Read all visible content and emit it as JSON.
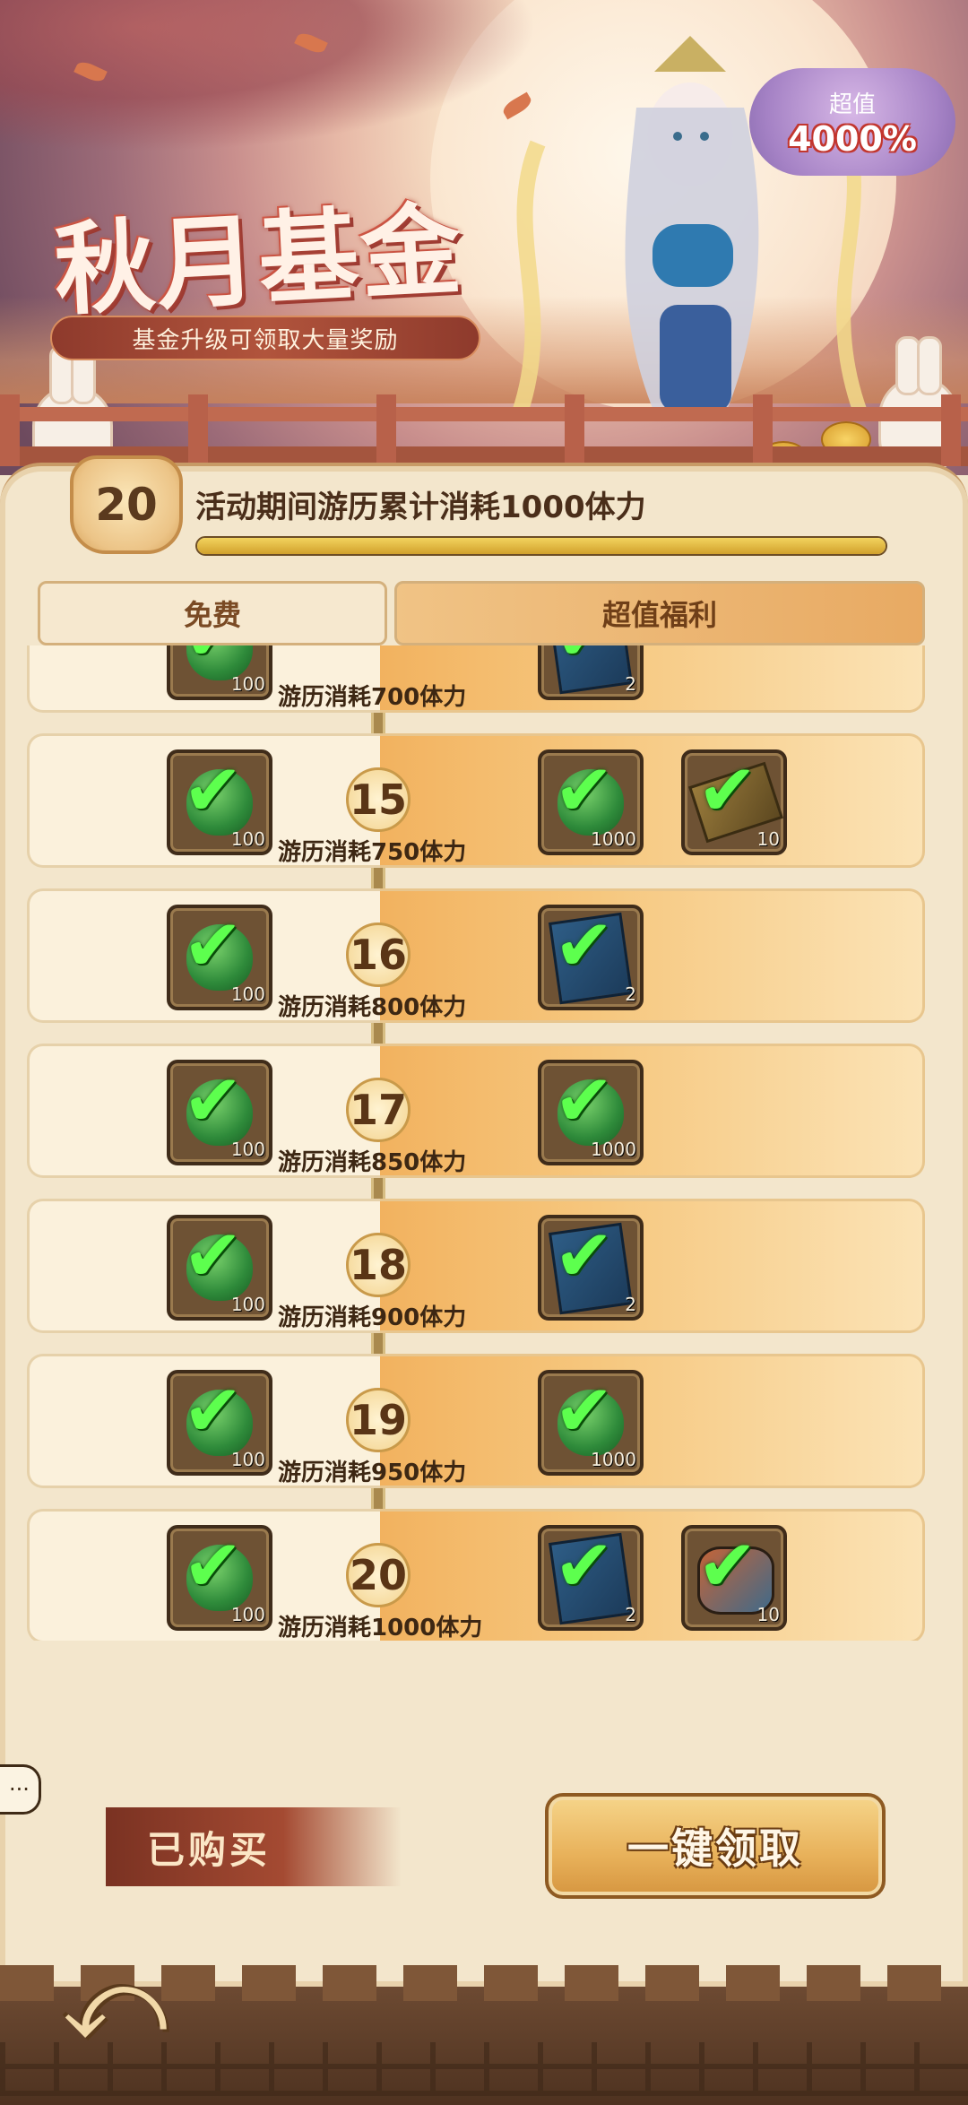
{
  "banner": {
    "title": "秋月基金",
    "subtitle": "基金升级可领取大量奖励",
    "value_badge": {
      "label": "超值",
      "value": "4000%"
    }
  },
  "progress": {
    "level": "20",
    "text": "活动期间游历累计消耗1000体力",
    "fraction": 1.0
  },
  "tabs": {
    "free": "免费",
    "premium": "超值福利"
  },
  "rows": [
    {
      "level": "",
      "label": "游历消耗700体力",
      "free": {
        "icon": "stamina-gem-icon",
        "qty": "100",
        "claimed": true
      },
      "premium": [
        {
          "icon": "scroll-icon",
          "qty": "2",
          "claimed": true
        }
      ]
    },
    {
      "level": "15",
      "label": "游历消耗750体力",
      "free": {
        "icon": "stamina-gem-icon",
        "qty": "100",
        "claimed": true
      },
      "premium": [
        {
          "icon": "stamina-gem-icon",
          "qty": "1000",
          "claimed": true
        },
        {
          "icon": "book-icon",
          "qty": "10",
          "claimed": true
        }
      ]
    },
    {
      "level": "16",
      "label": "游历消耗800体力",
      "free": {
        "icon": "stamina-gem-icon",
        "qty": "100",
        "claimed": true
      },
      "premium": [
        {
          "icon": "scroll-icon",
          "qty": "2",
          "claimed": true
        }
      ]
    },
    {
      "level": "17",
      "label": "游历消耗850体力",
      "free": {
        "icon": "stamina-gem-icon",
        "qty": "100",
        "claimed": true
      },
      "premium": [
        {
          "icon": "stamina-gem-icon",
          "qty": "1000",
          "claimed": true
        }
      ]
    },
    {
      "level": "18",
      "label": "游历消耗900体力",
      "free": {
        "icon": "stamina-gem-icon",
        "qty": "100",
        "claimed": true
      },
      "premium": [
        {
          "icon": "scroll-icon",
          "qty": "2",
          "claimed": true
        }
      ]
    },
    {
      "level": "19",
      "label": "游历消耗950体力",
      "free": {
        "icon": "stamina-gem-icon",
        "qty": "100",
        "claimed": true
      },
      "premium": [
        {
          "icon": "stamina-gem-icon",
          "qty": "1000",
          "claimed": true
        }
      ]
    },
    {
      "level": "20",
      "label": "游历消耗1000体力",
      "free": {
        "icon": "stamina-gem-icon",
        "qty": "100",
        "claimed": true
      },
      "premium": [
        {
          "icon": "scroll-icon",
          "qty": "2",
          "claimed": true
        },
        {
          "icon": "ore-icon",
          "qty": "10",
          "claimed": true
        }
      ]
    }
  ],
  "footer": {
    "purchased_label": "已购买",
    "claim_all_label": "一键领取"
  },
  "icons": {
    "check": "✔",
    "back": "⤺",
    "chat": "···"
  },
  "colors": {
    "premium_accent": "#f2b25f",
    "check_green": "#5dff4e",
    "panel": "#f3e6cc"
  }
}
